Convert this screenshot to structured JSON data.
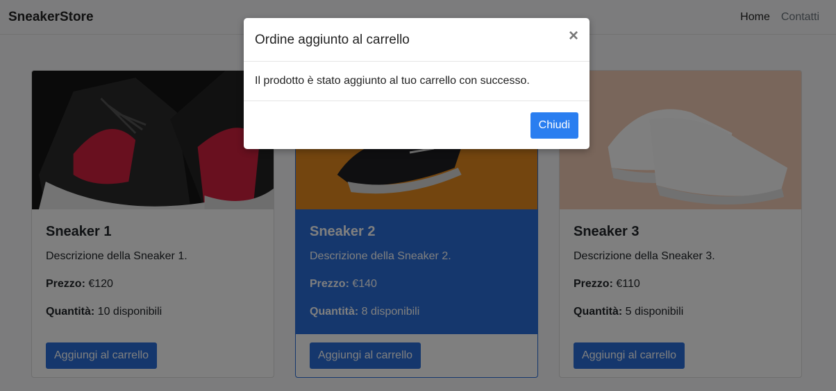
{
  "navbar": {
    "brand": "SneakerStore",
    "links": [
      "Home",
      "Contatti"
    ]
  },
  "products": [
    {
      "title": "Sneaker 1",
      "description": "Descrizione della Sneaker 1.",
      "price_label": "Prezzo:",
      "price": "€120",
      "qty_label": "Quantità:",
      "qty": "10 disponibili",
      "button": "Aggiungi al carrello",
      "image": "red-black-high-top-sneakers"
    },
    {
      "title": "Sneaker 2",
      "description": "Descrizione della Sneaker 2.",
      "price_label": "Prezzo:",
      "price": "€140",
      "qty_label": "Quantità:",
      "qty": "8 disponibili",
      "button": "Aggiungi al carrello",
      "image": "black-running-shoe-orange-background"
    },
    {
      "title": "Sneaker 3",
      "description": "Descrizione della Sneaker 3.",
      "price_label": "Prezzo:",
      "price": "€110",
      "qty_label": "Quantità:",
      "qty": "5 disponibili",
      "button": "Aggiungi al carrello",
      "image": "white-low-top-sneakers"
    }
  ],
  "modal": {
    "title": "Ordine aggiunto al carrello",
    "close_icon": "×",
    "message": "Il prodotto è stato aggiunto al tuo carrello con successo.",
    "button": "Chiudi"
  },
  "colors": {
    "accent": "#2a6fdb",
    "overlay": "rgba(0,0,0,0.5)"
  }
}
